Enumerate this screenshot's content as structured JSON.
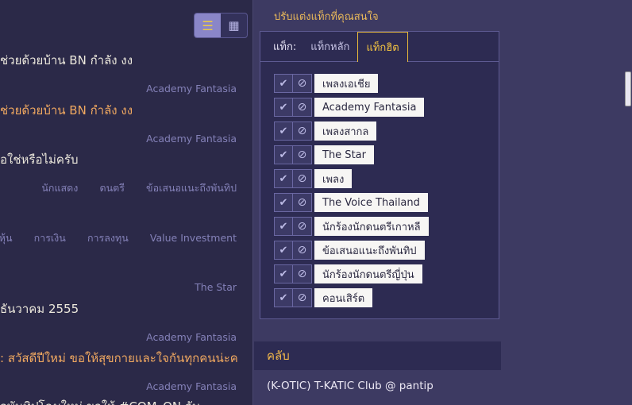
{
  "feed": {
    "items": [
      {
        "title": "ช่วยด้วยบ้าน BN กำลัง งง",
        "tags": [
          "Academy Fantasia"
        ],
        "orange": false
      },
      {
        "title": "ช่วยด้วยบ้าน BN กำลัง งง",
        "tags": [
          "Academy Fantasia"
        ],
        "orange": true
      },
      {
        "title": "อใช่หรือไม่ครับ",
        "tags": [
          "นักแสดง",
          "ดนตรี",
          "ข้อเสนอแนะถึงพันทิป"
        ],
        "orange": false
      },
      {
        "title": "",
        "tags": [
          "หุ้น",
          "การเงิน",
          "การลงทุน",
          "Value Investment"
        ],
        "orange": false
      },
      {
        "title": "",
        "tags": [
          "The Star"
        ],
        "orange": false
      },
      {
        "title": "ธันวาคม 2555",
        "tags": [
          "Academy Fantasia"
        ],
        "orange": false
      },
      {
        "title": ": สวัสดีปีใหม่ ขอให้สุขกายและใจกันทุกคนน่ะค",
        "tags": [
          "Academy Fantasia"
        ],
        "orange": true
      },
      {
        "title": "อพันทิปโฉมใหม่ ขอให้ #COM_ON ลับ",
        "tags": [],
        "orange": false
      }
    ]
  },
  "interest": {
    "title": "ปรับแต่งแท็กที่คุณสนใจ",
    "tab_prefix": "แท็ก:",
    "tabs": [
      {
        "label": "แท็กหลัก",
        "active": false
      },
      {
        "label": "แท็กฮิต",
        "active": true
      }
    ],
    "tags": [
      "เพลงเอเชีย",
      "Academy Fantasia",
      "เพลงสากล",
      "The Star",
      "เพลง",
      "The Voice Thailand",
      "นักร้องนักดนตรีเกาหลี",
      "ข้อเสนอแนะถึงพันทิป",
      "นักร้องนักดนตรีญี่ปุ่น",
      "คอนเสิร์ต"
    ]
  },
  "club": {
    "header": "คลับ",
    "items": [
      "(K-OTIC) T-KATIC Club @ pantip"
    ]
  },
  "icons": {
    "list_view": "list-view-icon",
    "grid_view": "grid-view-icon",
    "check": "check-icon",
    "block": "block-icon"
  },
  "colors": {
    "accent": "#f5c542",
    "title_orange": "#f0a860",
    "tag_gray": "#8481b8"
  }
}
